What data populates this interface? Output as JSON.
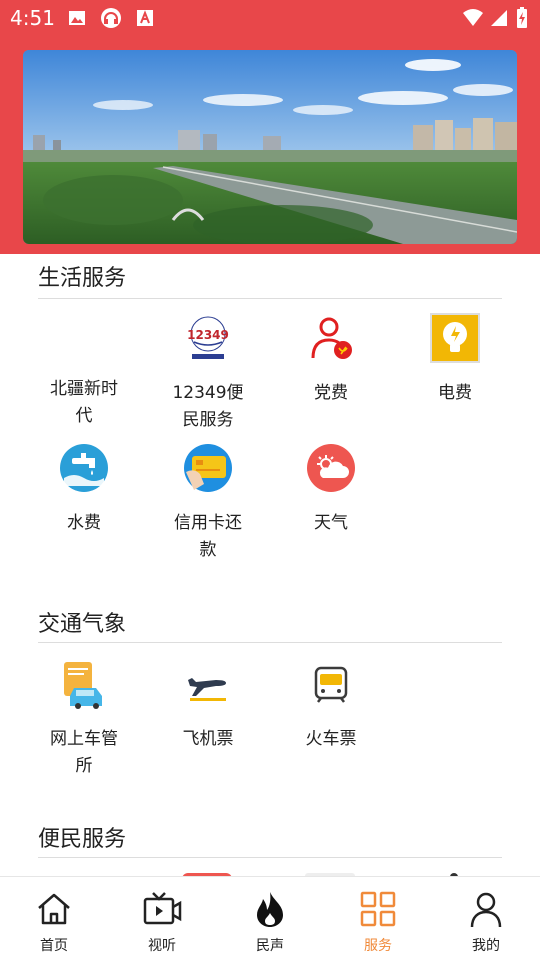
{
  "status_bar": {
    "time": "4:51"
  },
  "sections": [
    {
      "title": "生活服务",
      "items": [
        {
          "label": "北疆新时代",
          "icon": "blank-icon"
        },
        {
          "label": "12349便民服务",
          "icon": "12349-logo-icon"
        },
        {
          "label": "党费",
          "icon": "party-member-icon"
        },
        {
          "label": "电费",
          "icon": "lightbulb-icon"
        },
        {
          "label": "水费",
          "icon": "water-faucet-icon"
        },
        {
          "label": "信用卡还款",
          "icon": "credit-card-icon"
        },
        {
          "label": "天气",
          "icon": "weather-icon"
        }
      ]
    },
    {
      "title": "交通气象",
      "items": [
        {
          "label": "网上车管所",
          "icon": "car-clipboard-icon"
        },
        {
          "label": "飞机票",
          "icon": "airplane-icon"
        },
        {
          "label": "火车票",
          "icon": "train-icon"
        }
      ]
    },
    {
      "title": "便民服务",
      "items": []
    }
  ],
  "tabbar": [
    {
      "label": "首页",
      "icon": "home-icon",
      "active": false
    },
    {
      "label": "视听",
      "icon": "tv-icon",
      "active": false
    },
    {
      "label": "民声",
      "icon": "flame-icon",
      "active": false
    },
    {
      "label": "服务",
      "icon": "grid-icon",
      "active": true
    },
    {
      "label": "我的",
      "icon": "user-icon",
      "active": false
    }
  ],
  "colors": {
    "brand_red": "#e8474a",
    "active_tab": "#f08a3a"
  }
}
